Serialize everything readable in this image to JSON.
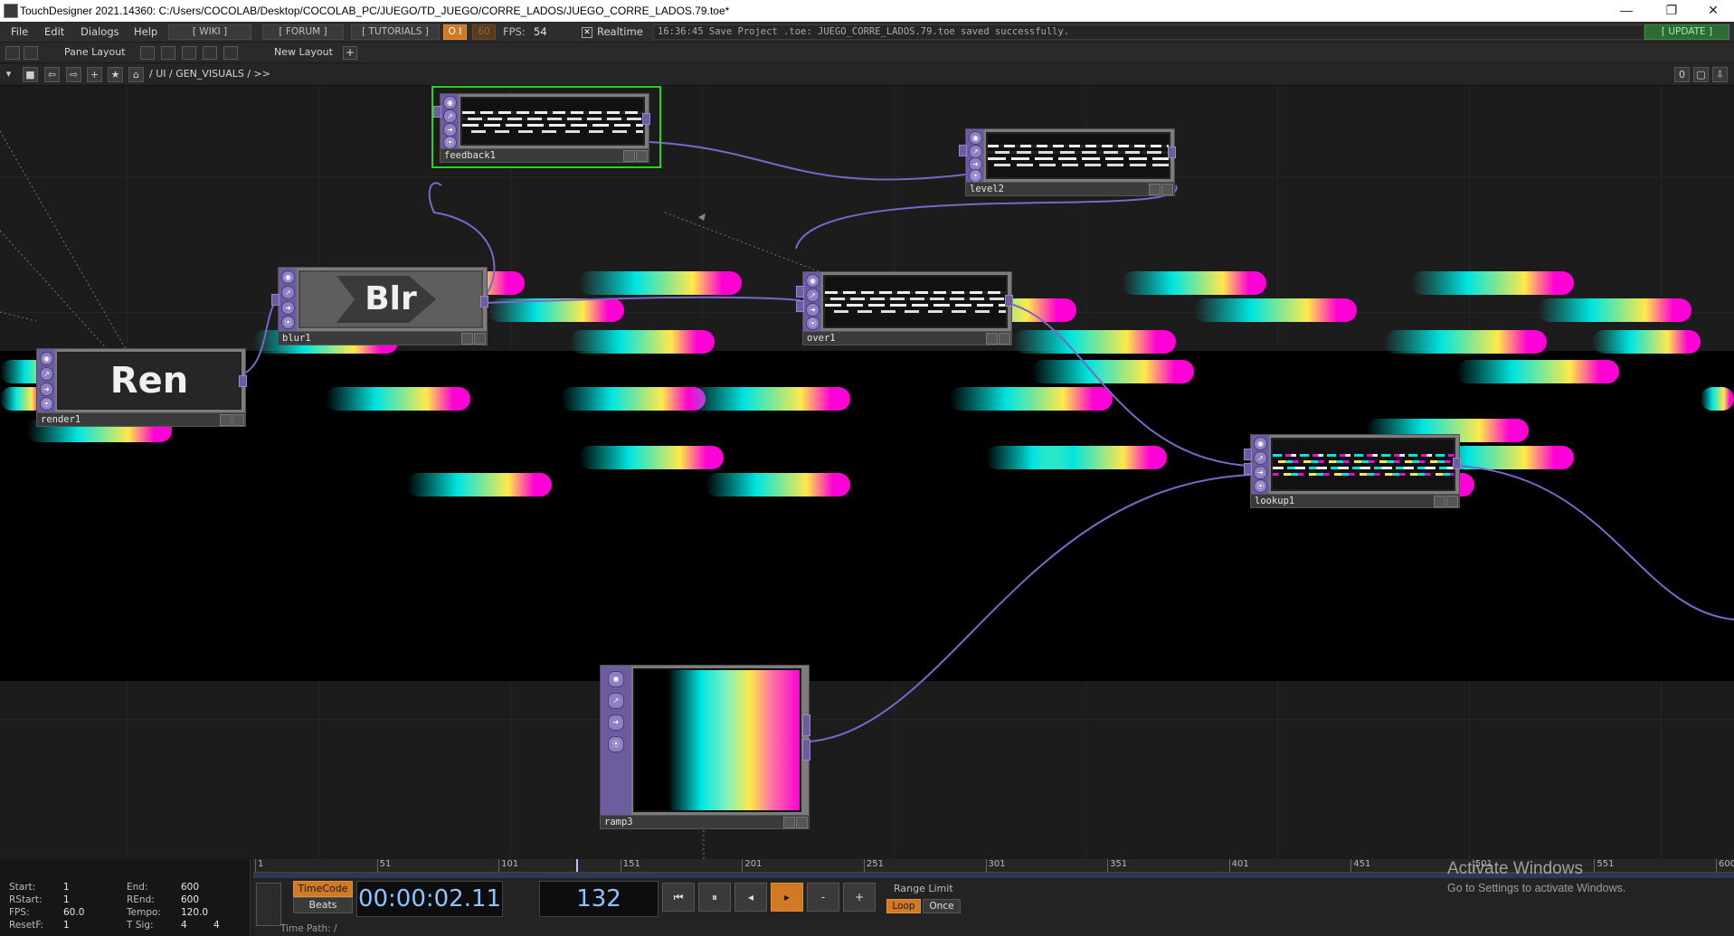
{
  "window": {
    "title": "TouchDesigner 2021.14360: C:/Users/COCOLAB/Desktop/COCOLAB_PC/JUEGO/TD_JUEGO/CORRE_LADOS/JUEGO_CORRE_LADOS.79.toe*",
    "minimize": "—",
    "maximize": "❐",
    "close": "✕"
  },
  "menubar": {
    "items": [
      "File",
      "Edit",
      "Dialogs",
      "Help"
    ],
    "wiki": "[ WIKI ]",
    "forum": "[ FORUM ]",
    "tutorials": "[ TUTORIALS ]",
    "oi": "O I",
    "fps_target": "60",
    "fps_label": "FPS:",
    "fps_value": "54",
    "realtime": "Realtime",
    "status": "16:36:45 Save Project .toe: JUEGO_CORRE_LADOS.79.toe saved successfully.",
    "update": "[ UPDATE ]"
  },
  "layoutbar": {
    "pane_layout": "Pane Layout",
    "new_layout": "New Layout",
    "plus": "+"
  },
  "pathbar": {
    "path": "/  UI  /  GEN_VISUALS  /  >>",
    "right_num": "0"
  },
  "nodes": {
    "feedback1": {
      "name": "feedback1"
    },
    "level2": {
      "name": "level2"
    },
    "blur1": {
      "name": "blur1",
      "label": "Blr"
    },
    "over1": {
      "name": "over1"
    },
    "render1": {
      "name": "render1",
      "label": "Ren"
    },
    "lookup1": {
      "name": "lookup1"
    },
    "ramp3": {
      "name": "ramp3"
    }
  },
  "colors": {
    "cyan": "#00e5e0",
    "yellow": "#ffe84a",
    "magenta": "#ff00d6",
    "selected": "#22d622",
    "wire": "#7b67c9",
    "node_side": "#6d5ca0"
  },
  "timeline": {
    "start_label": "Start:",
    "start": "1",
    "end_label": "End:",
    "end": "600",
    "rstart_label": "RStart:",
    "rstart": "1",
    "rend_label": "REnd:",
    "rend": "600",
    "fps_label": "FPS:",
    "fps": "60.0",
    "tempo_label": "Tempo:",
    "tempo": "120.0",
    "resetf_label": "ResetF:",
    "resetf": "1",
    "tsig_label": "T Sig:",
    "tsig_a": "4",
    "tsig_b": "4",
    "ticks": [
      "1",
      "51",
      "101",
      "151",
      "201",
      "251",
      "301",
      "351",
      "401",
      "451",
      "501",
      "551",
      "600"
    ],
    "timecode_label": "TimeCode",
    "beats_label": "Beats",
    "timecode": "00:00:02.11",
    "frame": "132",
    "range_limit": "Range Limit",
    "loop": "Loop",
    "once": "Once",
    "minus": "-",
    "plus": "+",
    "time_path": "Time Path: /"
  },
  "watermark": {
    "line1": "Activate Windows",
    "line2": "Go to Settings to activate Windows."
  }
}
